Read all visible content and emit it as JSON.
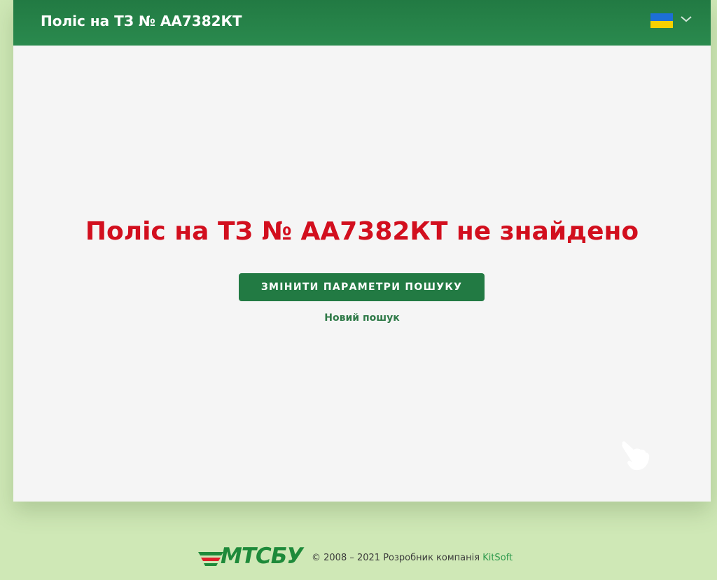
{
  "header": {
    "title": "Поліс на ТЗ № АА7382КТ",
    "language": {
      "flag_icon": "ukraine-flag-icon",
      "flag_colors": [
        "#1d6fd6",
        "#f6d000"
      ],
      "chevron_icon": "chevron-down-icon"
    }
  },
  "main": {
    "message": "Поліс на ТЗ № АА7382КТ не знайдено",
    "change_button_label": "ЗМІНИТИ ПАРАМЕТРИ ПОШУКУ",
    "new_search_label": "Новий пошук",
    "pointer_icon": "hand-pointer-icon"
  },
  "footer": {
    "logo_text": "МТСБУ",
    "copyright_text": "© 2008 – 2021 Розробник компанія ",
    "developer_name": "KitSoft"
  },
  "colors": {
    "page_background": "#cfe8b6",
    "header": "#227a43",
    "error_text": "#d20f1e",
    "button": "#227a43",
    "link": "#2f7a48",
    "logo_green": "#1e8a3a",
    "logo_red": "#e0202a"
  }
}
